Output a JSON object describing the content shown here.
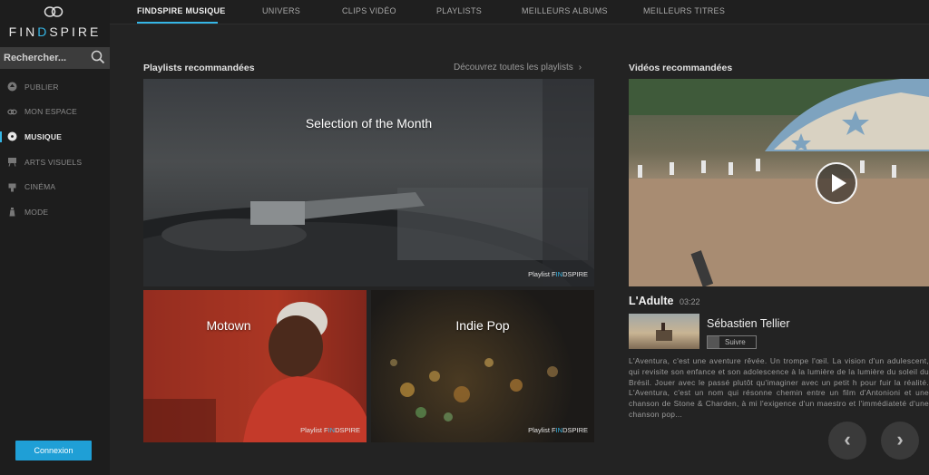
{
  "brand": {
    "name_pre": "FIN",
    "name_hl": "D",
    "name_post": "SPIRE",
    "accent": "#35b6e6"
  },
  "search": {
    "placeholder": "Rechercher..."
  },
  "sidebar": {
    "items": [
      {
        "label": "PUBLIER",
        "icon": "upload-icon"
      },
      {
        "label": "MON ESPACE",
        "icon": "infinity-icon"
      },
      {
        "label": "MUSIQUE",
        "icon": "vinyl-icon"
      },
      {
        "label": "ARTS VISUELS",
        "icon": "easel-icon"
      },
      {
        "label": "CINÉMA",
        "icon": "clapper-icon"
      },
      {
        "label": "MODE",
        "icon": "hanger-icon"
      }
    ],
    "login": "Connexion"
  },
  "topnav": {
    "tabs": [
      "FINDSPIRE MUSIQUE",
      "UNIVERS",
      "CLIPS VIDÉO",
      "PLAYLISTS",
      "MEILLEURS ALBUMS",
      "MEILLEURS TITRES"
    ]
  },
  "playlists": {
    "title": "Playlists recommandées",
    "see_all": "Découvrez toutes les playlists",
    "items": [
      {
        "title": "Selection of the Month",
        "badge_pre": "Playlist F",
        "badge_hl": "IN",
        "badge_post": "DSPIRE"
      },
      {
        "title": "Motown",
        "badge_pre": "Playlist F",
        "badge_hl": "IN",
        "badge_post": "DSPIRE"
      },
      {
        "title": "Indie Pop",
        "badge_pre": "Playlist F",
        "badge_hl": "IN",
        "badge_post": "DSPIRE"
      }
    ]
  },
  "videos": {
    "title": "Vidéos recommandées",
    "current": {
      "title": "L'Adulte",
      "duration": "03:22",
      "artist": "Sébastien Tellier",
      "follow": "Suivre",
      "description": "L'Aventura, c'est une aventure rêvée. Un trompe l'œil. La vision d'un adulescent, qui revisite son enfance et son adolescence à la lumière de la lumière du soleil du Brésil. Jouer avec le passé plutôt qu'imaginer avec un petit h pour fuir la réalité. L'Aventura, c'est un nom qui résonne chemin entre un film d'Antonioni et une chanson de Stone & Charden, à mi l'exigence d'un maestro et l'immédiateté d'une chanson pop..."
    }
  }
}
